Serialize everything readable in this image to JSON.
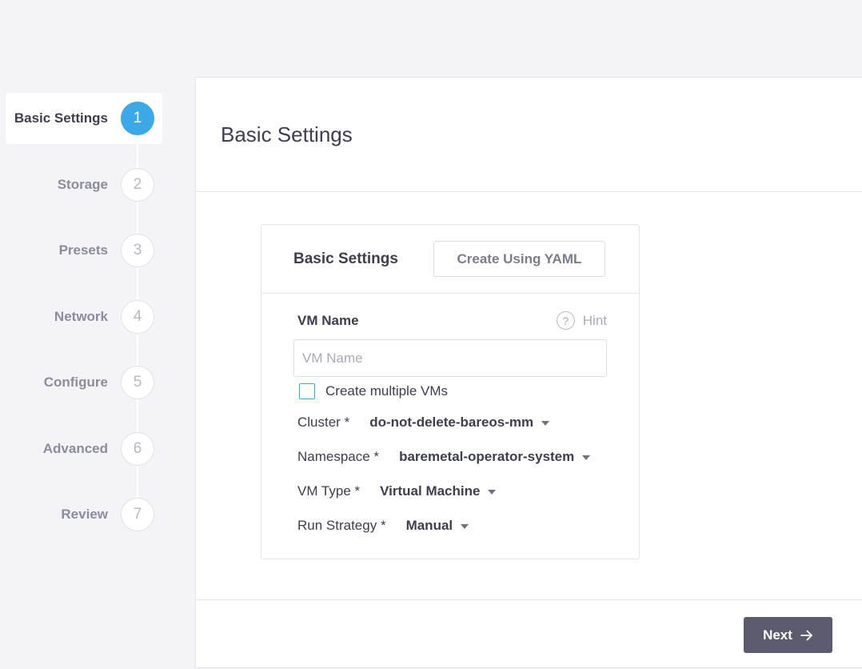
{
  "stepper": {
    "steps": [
      {
        "label": "Basic Settings",
        "number": "1"
      },
      {
        "label": "Storage",
        "number": "2"
      },
      {
        "label": "Presets",
        "number": "3"
      },
      {
        "label": "Network",
        "number": "4"
      },
      {
        "label": "Configure",
        "number": "5"
      },
      {
        "label": "Advanced",
        "number": "6"
      },
      {
        "label": "Review",
        "number": "7"
      }
    ],
    "active_step": "1"
  },
  "page": {
    "title": "Basic Settings"
  },
  "card": {
    "title": "Basic Settings",
    "yaml_button": "Create Using YAML",
    "vm_name_label": "VM Name",
    "hint_label": "Hint",
    "hint_icon_glyph": "?",
    "vm_name_placeholder": "VM Name",
    "vm_name_value": "",
    "multiple_vms_label": "Create multiple VMs",
    "multiple_vms_checked": false,
    "cluster": {
      "label": "Cluster *",
      "value": "do-not-delete-bareos-mm"
    },
    "namespace": {
      "label": "Namespace *",
      "value": "baremetal-operator-system"
    },
    "vm_type": {
      "label": "VM Type *",
      "value": "Virtual Machine"
    },
    "run_strategy": {
      "label": "Run Strategy *",
      "value": "Manual"
    }
  },
  "footer": {
    "next_button": "Next"
  },
  "colors": {
    "accent": "#3ba9e7",
    "primary_button": "#5a5c6e",
    "background": "#f3f3f8"
  },
  "icons": {
    "hint": "question-circle-icon",
    "select_caret": "caret-down-icon",
    "next": "arrow-right-icon"
  }
}
